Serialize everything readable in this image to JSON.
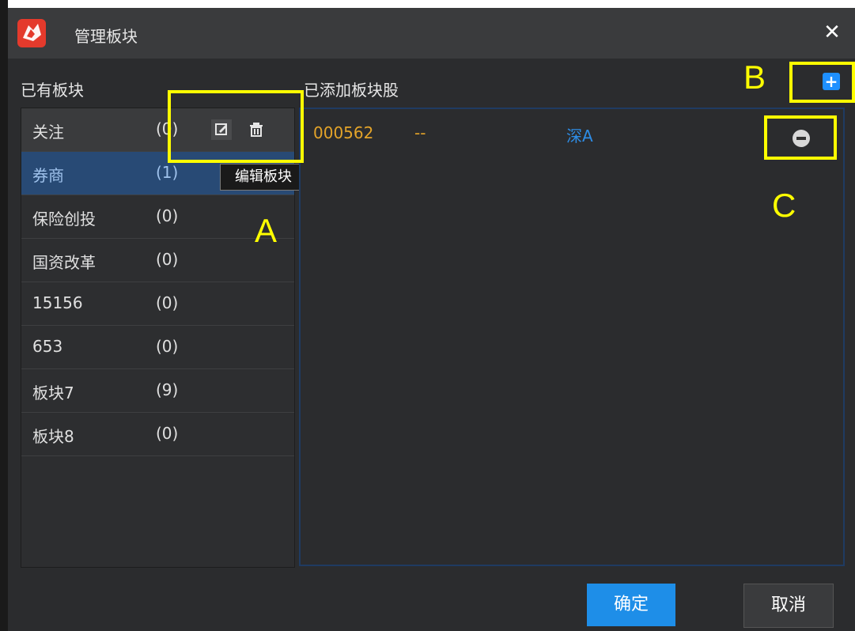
{
  "title": "管理板块",
  "close_label": "✕",
  "left_header": "已有板块",
  "right_header": "已添加板块股",
  "blocks": [
    {
      "name": "关注",
      "count": "(0)"
    },
    {
      "name": "券商",
      "count": "(1)"
    },
    {
      "name": "保险创投",
      "count": "(0)"
    },
    {
      "name": "国资改革",
      "count": "(0)"
    },
    {
      "name": "15156",
      "count": "(0)"
    },
    {
      "name": "653",
      "count": "(0)"
    },
    {
      "name": "板块7",
      "count": "(9)"
    },
    {
      "name": "板块8",
      "count": "(0)"
    }
  ],
  "tooltip": "编辑板块",
  "stocks": [
    {
      "code": "000562",
      "name": "--",
      "market": "深A"
    }
  ],
  "add_label": "+",
  "ok_label": "确定",
  "cancel_label": "取消",
  "annotations": {
    "a": "A",
    "b": "B",
    "c": "C"
  },
  "colors": {
    "highlight_yellow": "#ffff00",
    "selected_row": "#284a75",
    "accent_blue": "#1e8ee8",
    "stock_code": "#e4a429",
    "market_blue": "#2e8de6"
  },
  "icons": [
    "app-logo-icon",
    "close-icon",
    "edit-icon",
    "trash-icon",
    "add-icon",
    "remove-icon"
  ]
}
